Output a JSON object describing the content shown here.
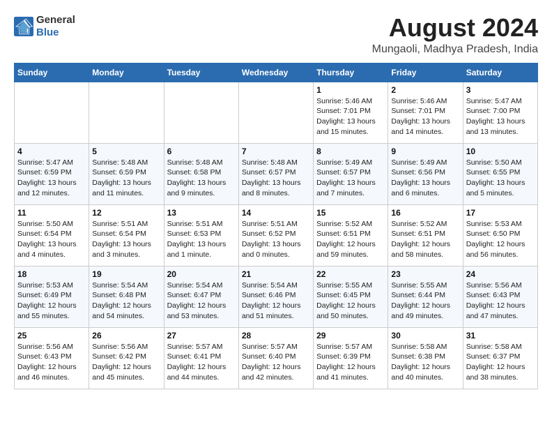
{
  "logo": {
    "general": "General",
    "blue": "Blue"
  },
  "header": {
    "month_year": "August 2024",
    "location": "Mungaoli, Madhya Pradesh, India"
  },
  "weekdays": [
    "Sunday",
    "Monday",
    "Tuesday",
    "Wednesday",
    "Thursday",
    "Friday",
    "Saturday"
  ],
  "weeks": [
    [
      {
        "day": "",
        "info": ""
      },
      {
        "day": "",
        "info": ""
      },
      {
        "day": "",
        "info": ""
      },
      {
        "day": "",
        "info": ""
      },
      {
        "day": "1",
        "info": "Sunrise: 5:46 AM\nSunset: 7:01 PM\nDaylight: 13 hours\nand 15 minutes."
      },
      {
        "day": "2",
        "info": "Sunrise: 5:46 AM\nSunset: 7:01 PM\nDaylight: 13 hours\nand 14 minutes."
      },
      {
        "day": "3",
        "info": "Sunrise: 5:47 AM\nSunset: 7:00 PM\nDaylight: 13 hours\nand 13 minutes."
      }
    ],
    [
      {
        "day": "4",
        "info": "Sunrise: 5:47 AM\nSunset: 6:59 PM\nDaylight: 13 hours\nand 12 minutes."
      },
      {
        "day": "5",
        "info": "Sunrise: 5:48 AM\nSunset: 6:59 PM\nDaylight: 13 hours\nand 11 minutes."
      },
      {
        "day": "6",
        "info": "Sunrise: 5:48 AM\nSunset: 6:58 PM\nDaylight: 13 hours\nand 9 minutes."
      },
      {
        "day": "7",
        "info": "Sunrise: 5:48 AM\nSunset: 6:57 PM\nDaylight: 13 hours\nand 8 minutes."
      },
      {
        "day": "8",
        "info": "Sunrise: 5:49 AM\nSunset: 6:57 PM\nDaylight: 13 hours\nand 7 minutes."
      },
      {
        "day": "9",
        "info": "Sunrise: 5:49 AM\nSunset: 6:56 PM\nDaylight: 13 hours\nand 6 minutes."
      },
      {
        "day": "10",
        "info": "Sunrise: 5:50 AM\nSunset: 6:55 PM\nDaylight: 13 hours\nand 5 minutes."
      }
    ],
    [
      {
        "day": "11",
        "info": "Sunrise: 5:50 AM\nSunset: 6:54 PM\nDaylight: 13 hours\nand 4 minutes."
      },
      {
        "day": "12",
        "info": "Sunrise: 5:51 AM\nSunset: 6:54 PM\nDaylight: 13 hours\nand 3 minutes."
      },
      {
        "day": "13",
        "info": "Sunrise: 5:51 AM\nSunset: 6:53 PM\nDaylight: 13 hours\nand 1 minute."
      },
      {
        "day": "14",
        "info": "Sunrise: 5:51 AM\nSunset: 6:52 PM\nDaylight: 13 hours\nand 0 minutes."
      },
      {
        "day": "15",
        "info": "Sunrise: 5:52 AM\nSunset: 6:51 PM\nDaylight: 12 hours\nand 59 minutes."
      },
      {
        "day": "16",
        "info": "Sunrise: 5:52 AM\nSunset: 6:51 PM\nDaylight: 12 hours\nand 58 minutes."
      },
      {
        "day": "17",
        "info": "Sunrise: 5:53 AM\nSunset: 6:50 PM\nDaylight: 12 hours\nand 56 minutes."
      }
    ],
    [
      {
        "day": "18",
        "info": "Sunrise: 5:53 AM\nSunset: 6:49 PM\nDaylight: 12 hours\nand 55 minutes."
      },
      {
        "day": "19",
        "info": "Sunrise: 5:54 AM\nSunset: 6:48 PM\nDaylight: 12 hours\nand 54 minutes."
      },
      {
        "day": "20",
        "info": "Sunrise: 5:54 AM\nSunset: 6:47 PM\nDaylight: 12 hours\nand 53 minutes."
      },
      {
        "day": "21",
        "info": "Sunrise: 5:54 AM\nSunset: 6:46 PM\nDaylight: 12 hours\nand 51 minutes."
      },
      {
        "day": "22",
        "info": "Sunrise: 5:55 AM\nSunset: 6:45 PM\nDaylight: 12 hours\nand 50 minutes."
      },
      {
        "day": "23",
        "info": "Sunrise: 5:55 AM\nSunset: 6:44 PM\nDaylight: 12 hours\nand 49 minutes."
      },
      {
        "day": "24",
        "info": "Sunrise: 5:56 AM\nSunset: 6:43 PM\nDaylight: 12 hours\nand 47 minutes."
      }
    ],
    [
      {
        "day": "25",
        "info": "Sunrise: 5:56 AM\nSunset: 6:43 PM\nDaylight: 12 hours\nand 46 minutes."
      },
      {
        "day": "26",
        "info": "Sunrise: 5:56 AM\nSunset: 6:42 PM\nDaylight: 12 hours\nand 45 minutes."
      },
      {
        "day": "27",
        "info": "Sunrise: 5:57 AM\nSunset: 6:41 PM\nDaylight: 12 hours\nand 44 minutes."
      },
      {
        "day": "28",
        "info": "Sunrise: 5:57 AM\nSunset: 6:40 PM\nDaylight: 12 hours\nand 42 minutes."
      },
      {
        "day": "29",
        "info": "Sunrise: 5:57 AM\nSunset: 6:39 PM\nDaylight: 12 hours\nand 41 minutes."
      },
      {
        "day": "30",
        "info": "Sunrise: 5:58 AM\nSunset: 6:38 PM\nDaylight: 12 hours\nand 40 minutes."
      },
      {
        "day": "31",
        "info": "Sunrise: 5:58 AM\nSunset: 6:37 PM\nDaylight: 12 hours\nand 38 minutes."
      }
    ]
  ]
}
